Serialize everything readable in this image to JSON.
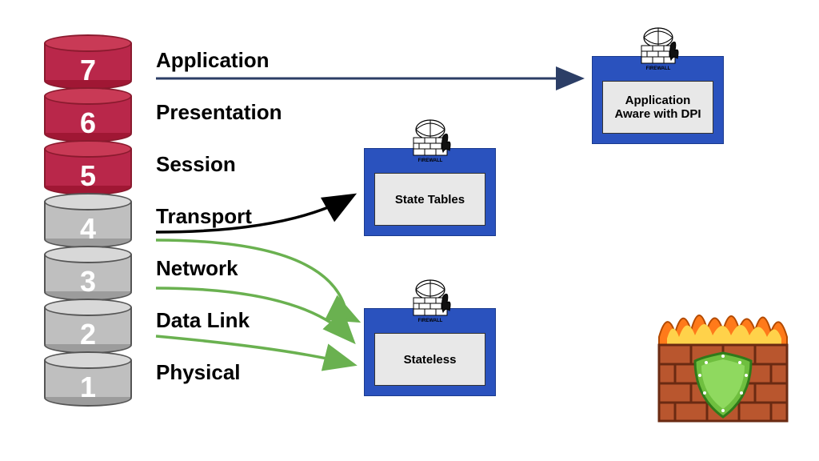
{
  "layers": [
    {
      "num": "7",
      "label": "Application"
    },
    {
      "num": "6",
      "label": "Presentation"
    },
    {
      "num": "5",
      "label": "Session"
    },
    {
      "num": "4",
      "label": "Transport"
    },
    {
      "num": "3",
      "label": "Network"
    },
    {
      "num": "2",
      "label": "Data Link"
    },
    {
      "num": "1",
      "label": "Physical"
    }
  ],
  "boxes": {
    "appAware": "Application Aware with DPI",
    "stateTables": "State Tables",
    "stateless": "Stateless"
  },
  "miniLabel": "FIREWALL"
}
